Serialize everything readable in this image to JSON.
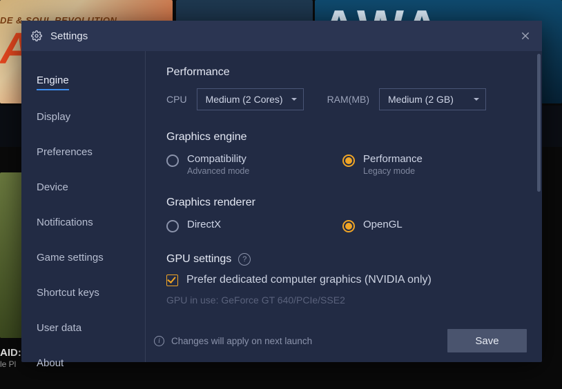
{
  "bg": {
    "txt1": "DE & SOUL REVOLUTION",
    "txt2": "AI",
    "txt3": "AWA",
    "txt4": "AID: S",
    "txt5": "le Pl"
  },
  "dialog": {
    "title": "Settings",
    "close_label": "Close"
  },
  "sidebar": {
    "items": [
      {
        "label": "Engine",
        "active": true
      },
      {
        "label": "Display"
      },
      {
        "label": "Preferences"
      },
      {
        "label": "Device"
      },
      {
        "label": "Notifications"
      },
      {
        "label": "Game settings"
      },
      {
        "label": "Shortcut keys"
      },
      {
        "label": "User data"
      },
      {
        "label": "About"
      }
    ]
  },
  "content": {
    "performance": {
      "heading": "Performance",
      "cpu_label": "CPU",
      "cpu_value": "Medium (2 Cores)",
      "ram_label": "RAM(MB)",
      "ram_value": "Medium (2 GB)"
    },
    "gengine": {
      "heading": "Graphics engine",
      "opt1": {
        "title": "Compatibility",
        "sub": "Advanced mode",
        "selected": false
      },
      "opt2": {
        "title": "Performance",
        "sub": "Legacy mode",
        "selected": true
      }
    },
    "grenderer": {
      "heading": "Graphics renderer",
      "opt1": {
        "title": "DirectX",
        "selected": false
      },
      "opt2": {
        "title": "OpenGL",
        "selected": true
      }
    },
    "gpu": {
      "heading": "GPU settings",
      "checkbox_label": "Prefer dedicated computer graphics (NVIDIA only)",
      "in_use": "GPU in use: GeForce GT 640/PCIe/SSE2"
    },
    "footer": {
      "info": "Changes will apply on next launch",
      "save": "Save"
    }
  }
}
